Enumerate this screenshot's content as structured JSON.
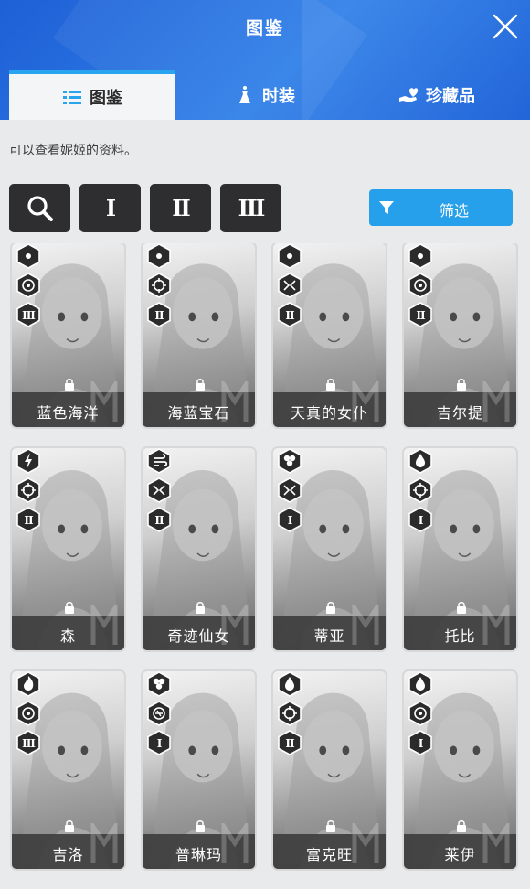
{
  "window": {
    "title": "图鉴"
  },
  "tabs": [
    {
      "label": "图鉴",
      "icon": "list-icon",
      "active": true
    },
    {
      "label": "时装",
      "icon": "dress-icon",
      "active": false
    },
    {
      "label": "珍藏品",
      "icon": "heart-hand-icon",
      "active": false
    }
  ],
  "description": "可以查看妮姬的资料。",
  "toolbar": {
    "search_icon": "search-icon",
    "burst_buttons": [
      "I",
      "II",
      "III"
    ],
    "filter_label": "筛选",
    "filter_icon": "funnel-icon"
  },
  "colors": {
    "header": "#1f63d8",
    "accent": "#29a4ee",
    "tool_button": "#2e2e30"
  },
  "characters": [
    {
      "name": "蓝色海洋",
      "element": "unknown",
      "weapon": "circle-target",
      "burst": "III"
    },
    {
      "name": "海蓝宝石",
      "element": "unknown",
      "weapon": "crosshair",
      "burst": "II"
    },
    {
      "name": "天真的女仆",
      "element": "unknown",
      "weapon": "bowtie",
      "burst": "II"
    },
    {
      "name": "吉尔提",
      "element": "unknown",
      "weapon": "circle-target",
      "burst": "II"
    },
    {
      "name": "森",
      "element": "electric",
      "weapon": "crosshair",
      "burst": "II"
    },
    {
      "name": "奇迹仙女",
      "element": "wind",
      "weapon": "bowtie",
      "burst": "II"
    },
    {
      "name": "蒂亚",
      "element": "iron",
      "weapon": "bowtie",
      "burst": "I"
    },
    {
      "name": "托比",
      "element": "water",
      "weapon": "crosshair",
      "burst": "I"
    },
    {
      "name": "吉洛",
      "element": "fire",
      "weapon": "circle-target",
      "burst": "III"
    },
    {
      "name": "普琳玛",
      "element": "iron",
      "weapon": "shotgun",
      "burst": "I"
    },
    {
      "name": "富克旺",
      "element": "water",
      "weapon": "crosshair",
      "burst": "II"
    },
    {
      "name": "莱伊",
      "element": "water",
      "weapon": "circle-target",
      "burst": "I"
    }
  ]
}
